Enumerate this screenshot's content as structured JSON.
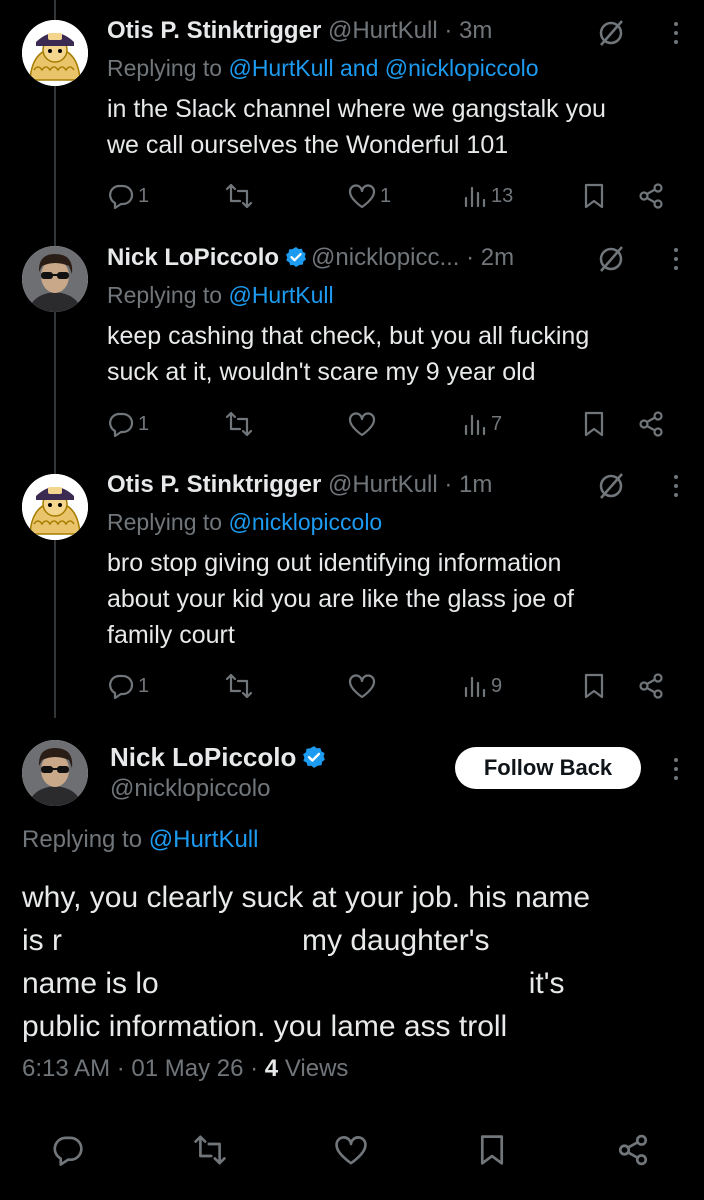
{
  "tweets": [
    {
      "name": "Otis P. Stinktrigger",
      "handle": "@HurtKull",
      "time": "· 3m",
      "replying_prefix": "Replying to",
      "replying_to": "@HurtKull and @nicklopiccolo",
      "text": "in the Slack channel where we gangstalk you\nwe call ourselves the Wonderful 101",
      "counts": {
        "replies": "1",
        "reposts": "",
        "likes": "1",
        "views": "13"
      }
    },
    {
      "name": "Nick LoPiccolo",
      "handle": "@nicklopicc...",
      "time": "· 2m",
      "replying_prefix": "Replying to",
      "replying_to": "@HurtKull",
      "text": "keep cashing that check, but you all fucking\nsuck at it, wouldn't scare my 9 year old",
      "counts": {
        "replies": "1",
        "reposts": "",
        "likes": "",
        "views": "7"
      }
    },
    {
      "name": "Otis P. Stinktrigger",
      "handle": "@HurtKull",
      "time": "· 1m",
      "replying_prefix": "Replying to",
      "replying_to": "@nicklopiccolo",
      "text": "bro stop giving out identifying information\nabout your kid you are like the glass joe of\nfamily court",
      "counts": {
        "replies": "1",
        "reposts": "",
        "likes": "",
        "views": "9"
      }
    }
  ],
  "main_tweet": {
    "name": "Nick LoPiccolo",
    "handle": "@nicklopiccolo",
    "follow_label": "Follow Back",
    "replying_prefix": "Replying to",
    "replying_to": "@HurtKull",
    "text_1": "why, you clearly suck at your job.  his name",
    "text_2a": "is r",
    "text_2b": "my daughter's",
    "text_3a": "name is lo",
    "text_3b": "it's",
    "text_4": "public information.  you lame ass troll",
    "time": "6:13 AM",
    "date": "01 May 26",
    "views_count": "4",
    "views_label": "Views"
  },
  "icons": [
    "reply-icon",
    "repost-icon",
    "like-icon",
    "views-icon",
    "bookmark-icon",
    "share-icon",
    "mute-icon",
    "verified-icon",
    "more-icon"
  ],
  "colors": {
    "background": "#000000",
    "text": "#e7e9ea",
    "muted": "#71767b",
    "link": "#1d9bf0",
    "verified": "#1d9bf0"
  }
}
